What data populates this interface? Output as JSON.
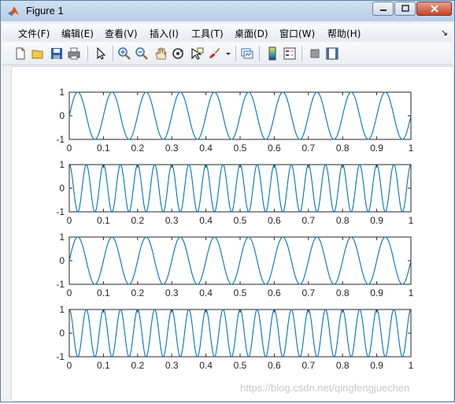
{
  "window": {
    "title": "Figure 1",
    "controls": {
      "minimize": "minimize",
      "maximize": "maximize",
      "close": "close"
    }
  },
  "menubar": {
    "items": [
      {
        "label": "文件(F)"
      },
      {
        "label": "编辑(E)"
      },
      {
        "label": "查看(V)"
      },
      {
        "label": "插入(I)"
      },
      {
        "label": "工具(T)"
      },
      {
        "label": "桌面(D)"
      },
      {
        "label": "窗口(W)"
      },
      {
        "label": "帮助(H)"
      }
    ],
    "overflow_arrow": "↘"
  },
  "toolbar": {
    "icons": [
      "new-figure-icon",
      "open-file-icon",
      "save-icon",
      "print-icon",
      "select-arrow-icon",
      "zoom-in-icon",
      "zoom-out-icon",
      "pan-icon",
      "rotate-3d-icon",
      "data-cursor-icon",
      "brush-icon",
      "brush-dropdown-icon",
      "link-plot-icon",
      "insert-colorbar-icon",
      "insert-legend-icon",
      "hide-plot-tools-icon",
      "show-plot-tools-icon"
    ]
  },
  "colors": {
    "line": "#0072BD",
    "axes": "#262626"
  },
  "chart_data": [
    {
      "type": "line",
      "xlim": [
        0,
        1
      ],
      "ylim": [
        -1,
        1
      ],
      "xticks": [
        "0",
        "0.1",
        "0.2",
        "0.3",
        "0.4",
        "0.5",
        "0.6",
        "0.7",
        "0.8",
        "0.9",
        "1"
      ],
      "yticks": [
        "1",
        "0",
        "-1"
      ],
      "function": "sin",
      "frequency": 10
    },
    {
      "type": "line",
      "xlim": [
        0,
        1
      ],
      "ylim": [
        -1,
        1
      ],
      "xticks": [
        "0",
        "0.1",
        "0.2",
        "0.3",
        "0.4",
        "0.5",
        "0.6",
        "0.7",
        "0.8",
        "0.9",
        "1"
      ],
      "yticks": [
        "1",
        "0",
        "-1"
      ],
      "function": "cos",
      "frequency": 20
    },
    {
      "type": "line",
      "xlim": [
        0,
        1
      ],
      "ylim": [
        -1,
        1
      ],
      "xticks": [
        "0",
        "0.1",
        "0.2",
        "0.3",
        "0.4",
        "0.5",
        "0.6",
        "0.7",
        "0.8",
        "0.9",
        "1"
      ],
      "yticks": [
        "1",
        "0",
        "-1"
      ],
      "function": "sin",
      "frequency": 10
    },
    {
      "type": "line",
      "xlim": [
        0,
        1
      ],
      "ylim": [
        -1,
        1
      ],
      "xticks": [
        "0",
        "0.1",
        "0.2",
        "0.3",
        "0.4",
        "0.5",
        "0.6",
        "0.7",
        "0.8",
        "0.9",
        "1"
      ],
      "yticks": [
        "1",
        "0",
        "-1"
      ],
      "function": "cos",
      "frequency": 20
    }
  ],
  "watermark": "https://blog.csdn.net/qingfengjuechen"
}
